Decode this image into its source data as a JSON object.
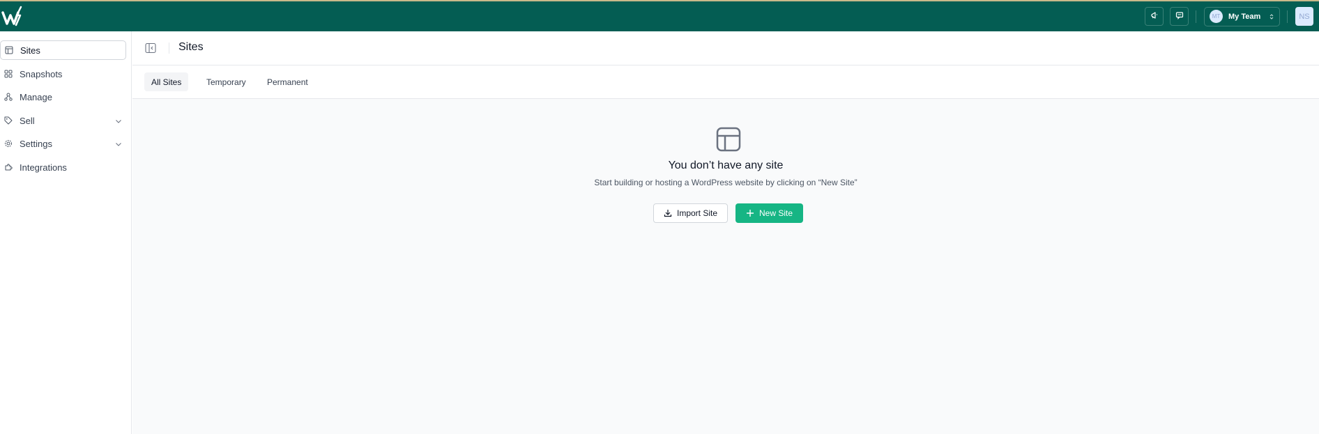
{
  "topbar": {
    "logo_icon": "wordpress-bolt-logo",
    "announce_icon": "megaphone-icon",
    "feedback_icon": "message-icon",
    "team": {
      "avatar_initials": "MT",
      "name": "My Team"
    },
    "user_initials": "NS",
    "colors": {
      "bar": "#045d53",
      "accent": "#16b584"
    }
  },
  "sidebar": {
    "items": [
      {
        "label": "Sites",
        "icon": "layout-icon",
        "active": true
      },
      {
        "label": "Snapshots",
        "icon": "grid-icon"
      },
      {
        "label": "Manage",
        "icon": "nodes-icon"
      },
      {
        "label": "Sell",
        "icon": "tag-icon",
        "expandable": true
      },
      {
        "label": "Settings",
        "icon": "gear-icon",
        "expandable": true
      },
      {
        "label": "Integrations",
        "icon": "puzzle-icon"
      }
    ]
  },
  "header": {
    "title": "Sites"
  },
  "tabs": [
    {
      "label": "All Sites",
      "active": true
    },
    {
      "label": "Temporary"
    },
    {
      "label": "Permanent"
    }
  ],
  "empty_state": {
    "title": "You don’t have any site",
    "subtitle": "Start building or hosting a WordPress website by clicking on “New Site”",
    "import_label": "Import Site",
    "new_label": "New Site"
  }
}
